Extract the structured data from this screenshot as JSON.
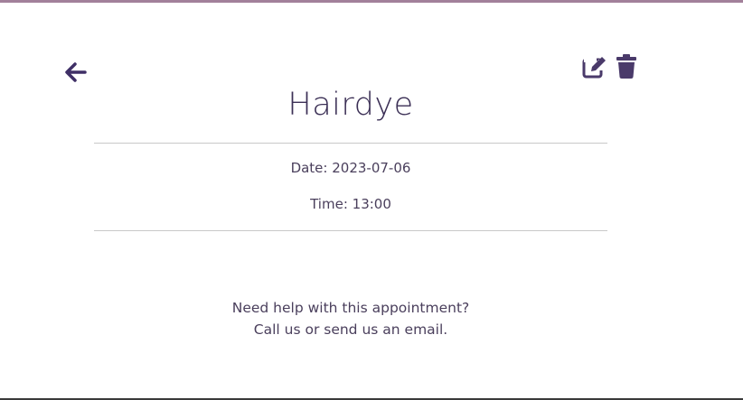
{
  "appointment": {
    "title": "Hairdye",
    "date_label": "Date:",
    "date_value": "2023-07-06",
    "time_label": "Time:",
    "time_value": "13:00"
  },
  "help": {
    "line1": "Need help with this appointment?",
    "line2": "Call us or send us an email."
  },
  "icons": {
    "back": "arrow-left-icon",
    "edit": "edit-icon",
    "delete": "trash-icon"
  },
  "colors": {
    "accent": "#3b2f55",
    "top_bar": "#a2809a",
    "icon": "#4a3a6a",
    "divider": "#c8c8c8"
  }
}
